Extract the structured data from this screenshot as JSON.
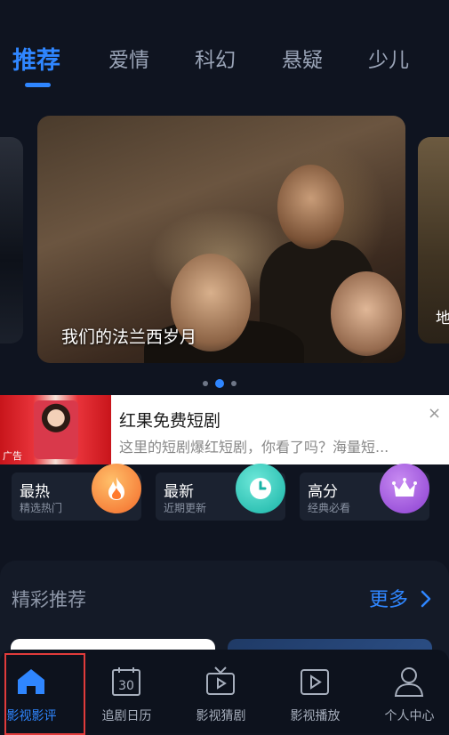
{
  "tabs": [
    {
      "label": "推荐"
    },
    {
      "label": "爱情"
    },
    {
      "label": "科幻"
    },
    {
      "label": "悬疑"
    },
    {
      "label": "少儿"
    }
  ],
  "carousel": {
    "main_title": "我们的法兰西岁月",
    "right_peek_text": "地",
    "active_index": 1,
    "dot_count": 3
  },
  "ad": {
    "title": "红果免费短剧",
    "description": "这里的短剧爆红短剧，你看了吗？海量短...",
    "tag": "广告",
    "close_icon": "×"
  },
  "categories": [
    {
      "title": "最热",
      "subtitle": "精选热门",
      "icon": "fire-icon",
      "color": "#f6893a"
    },
    {
      "title": "最新",
      "subtitle": "近期更新",
      "icon": "clock-icon",
      "color": "#1fc2b3"
    },
    {
      "title": "高分",
      "subtitle": "经典必看",
      "icon": "crown-icon",
      "color": "#a35ae0"
    }
  ],
  "recommend": {
    "title": "精彩推荐",
    "more_label": "更多",
    "more_icon": "chevron-right-icon"
  },
  "bottom_nav": [
    {
      "label": "影视影评",
      "icon": "home-icon",
      "active": true
    },
    {
      "label": "追剧日历",
      "icon": "calendar-icon",
      "calendar_day": "30"
    },
    {
      "label": "影视猜剧",
      "icon": "tv-icon"
    },
    {
      "label": "影视播放",
      "icon": "play-icon"
    },
    {
      "label": "个人中心",
      "icon": "user-icon"
    }
  ],
  "colors": {
    "accent": "#2f86ff",
    "background": "#0f1420"
  }
}
